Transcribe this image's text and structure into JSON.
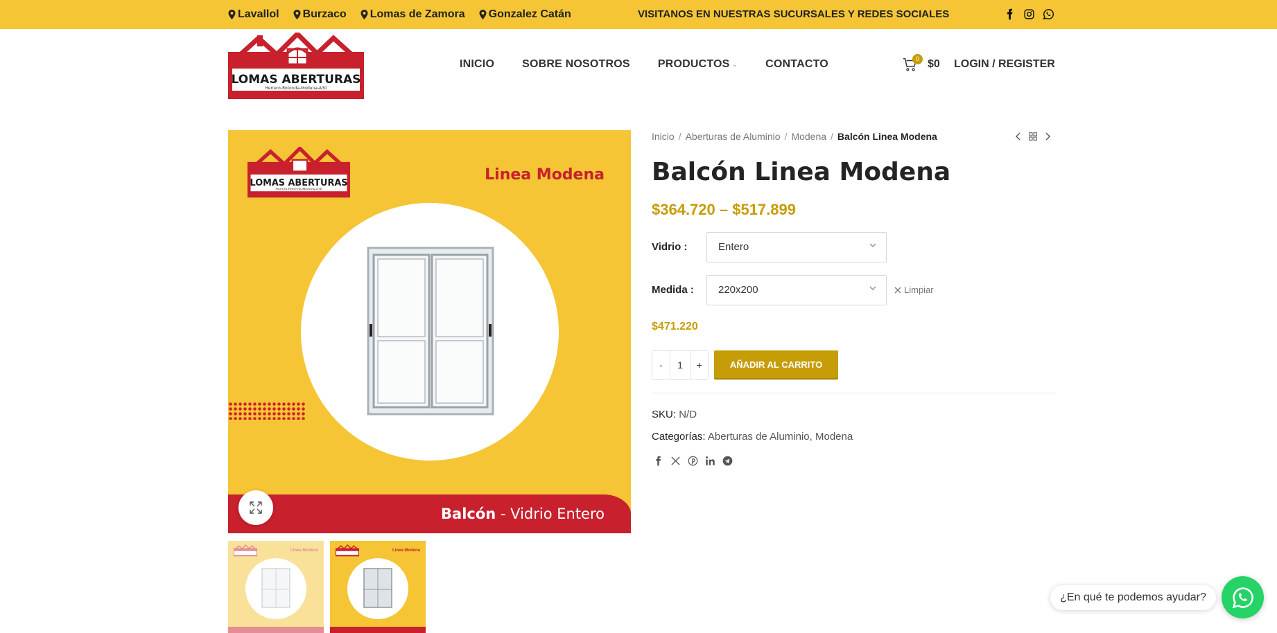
{
  "topbar": {
    "locations": [
      "Lavallol",
      "Burzaco",
      "Lomas de Zamora",
      "Gonzalez Catán"
    ],
    "message": "VISITANOS EN NUESTRAS SUCURSALES Y REDES SOCIALES",
    "social_icons": [
      "facebook-icon",
      "instagram-icon",
      "whatsapp-icon"
    ]
  },
  "logo": {
    "name": "LOMAS ABERTURAS",
    "tagline": "Herrero-Rotonda-Modena-A30"
  },
  "nav": {
    "items": [
      "INICIO",
      "SOBRE NOSOTROS",
      "PRODUCTOS",
      "CONTACTO"
    ]
  },
  "cart": {
    "count": "0",
    "total": "$0"
  },
  "account": {
    "login_label": "LOGIN / REGISTER"
  },
  "breadcrumb": {
    "items": [
      "Inicio",
      "Aberturas de Aluminio",
      "Modena"
    ],
    "current": "Balcón Linea Modena"
  },
  "product": {
    "title": "Balcón Linea Modena",
    "price_range": "$364.720 – $517.899",
    "image": {
      "line_label": "Linea Modena",
      "banner_bold": "Balcón",
      "banner_rest": " - Vidrio Entero"
    },
    "variations": [
      {
        "label": "Vidrio",
        "value": "Entero"
      },
      {
        "label": "Medida",
        "value": "220x200"
      }
    ],
    "clear_label": "Limpiar",
    "variation_price": "$471.220",
    "quantity": "1",
    "minus": "-",
    "plus": "+",
    "add_to_cart": "AÑADIR AL CARRITO",
    "sku_label": "SKU:",
    "sku_value": "N/D",
    "categories_label": "Categorías:",
    "categories": [
      "Aberturas de Aluminio",
      "Modena"
    ],
    "share_icons": [
      "facebook-icon",
      "x-icon",
      "pinterest-icon",
      "linkedin-icon",
      "telegram-icon"
    ]
  },
  "whatsapp": {
    "bubble_text": "¿En qué te podemos ayudar?"
  },
  "colors": {
    "brand_yellow": "#f5c535",
    "brand_red": "#c8202d",
    "accent_gold": "#c69c07"
  }
}
